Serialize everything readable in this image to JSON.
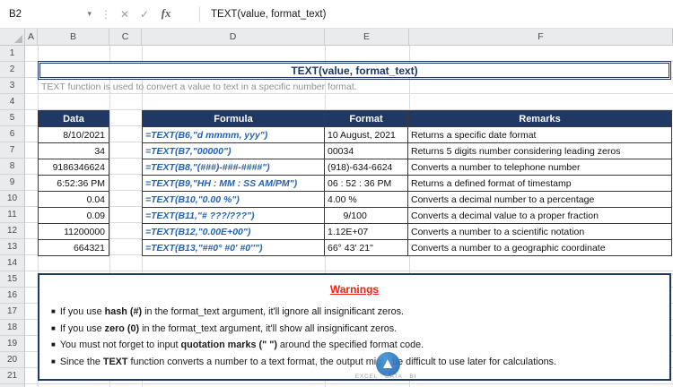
{
  "colors": {
    "navy": "#1f3864",
    "formula_blue": "#2563b0",
    "warning_red": "#ee2313",
    "watermark_blue": "#2e75b6"
  },
  "formula_bar": {
    "name_box": "B2",
    "icons": {
      "dropdown": "▾",
      "drag_dots": "⋮"
    },
    "cancel_label": "✕",
    "confirm_label": "✓",
    "fx_label": "fx",
    "formula": "TEXT(value, format_text)"
  },
  "sheet": {
    "columns": [
      "A",
      "B",
      "C",
      "D",
      "E",
      "F"
    ],
    "rows": [
      "1",
      "2",
      "3",
      "4",
      "5",
      "6",
      "7",
      "8",
      "9",
      "10",
      "11",
      "12",
      "13",
      "14",
      "15",
      "16",
      "17",
      "18",
      "19",
      "20",
      "21"
    ]
  },
  "title": "TEXT(value, format_text)",
  "subtitle": "TEXT function is used to convert a value to text in a specific number format.",
  "table": {
    "data_header": "Data",
    "headers": [
      "Formula",
      "Format",
      "Remarks"
    ],
    "rows": [
      {
        "data": "8/10/2021",
        "formula": "=TEXT(B6,\"d mmmm, yyy\")",
        "format": "10 August, 2021",
        "remarks": "Returns a specific date format"
      },
      {
        "data": "34",
        "formula": "=TEXT(B7,\"00000\")",
        "format": "00034",
        "remarks": "Returns 5 digits number considering leading zeros"
      },
      {
        "data": "9186346624",
        "formula": "=TEXT(B8,\"(###)-###-####\")",
        "format": "(918)-634-6624",
        "remarks": "Converts a number to telephone number"
      },
      {
        "data": "6:52:36 PM",
        "formula": "=TEXT(B9,\"HH : MM : SS AM/PM\")",
        "format": "06 : 52 : 36 PM",
        "remarks": "Returns a defined format of timestamp"
      },
      {
        "data": "0.04",
        "formula": "=TEXT(B10,\"0.00 %\")",
        "format": "4.00 %",
        "remarks": "Converts a decimal number to a percentage"
      },
      {
        "data": "0.09",
        "formula": "=TEXT(B11,\"# ???/???\")",
        "format": "      9/100",
        "remarks": "Converts a decimal value to a proper fraction"
      },
      {
        "data": "11200000",
        "formula": "=TEXT(B12,\"0.00E+00\")",
        "format": "1.12E+07",
        "remarks": "Converts a number to a scientific notation"
      },
      {
        "data": "664321",
        "formula": "=TEXT(B13,\"##0° #0' #0''\")",
        "format": "66° 43' 21\"",
        "remarks": "Converts a number to a geographic coordinate"
      }
    ]
  },
  "warnings": {
    "title": "Warnings",
    "bullet": "■",
    "items": [
      {
        "pre": "If you use ",
        "bold": "hash (#)",
        "post": " in the format_text argument, it'll ignore all insignificant zeros."
      },
      {
        "pre": "If you use ",
        "bold": "zero (0)",
        "post": " in the format_text argument, it'll show all insignificant zeros."
      },
      {
        "pre": "You must not forget to input ",
        "bold": "quotation marks (\" \")",
        "post": " around the specified format code."
      },
      {
        "pre": "Since the ",
        "bold": "TEXT",
        "post": " function converts a number to a text format, the output might be difficult to use later for calculations."
      }
    ]
  },
  "watermark": {
    "text": "EXCEL · DATA · BI"
  }
}
